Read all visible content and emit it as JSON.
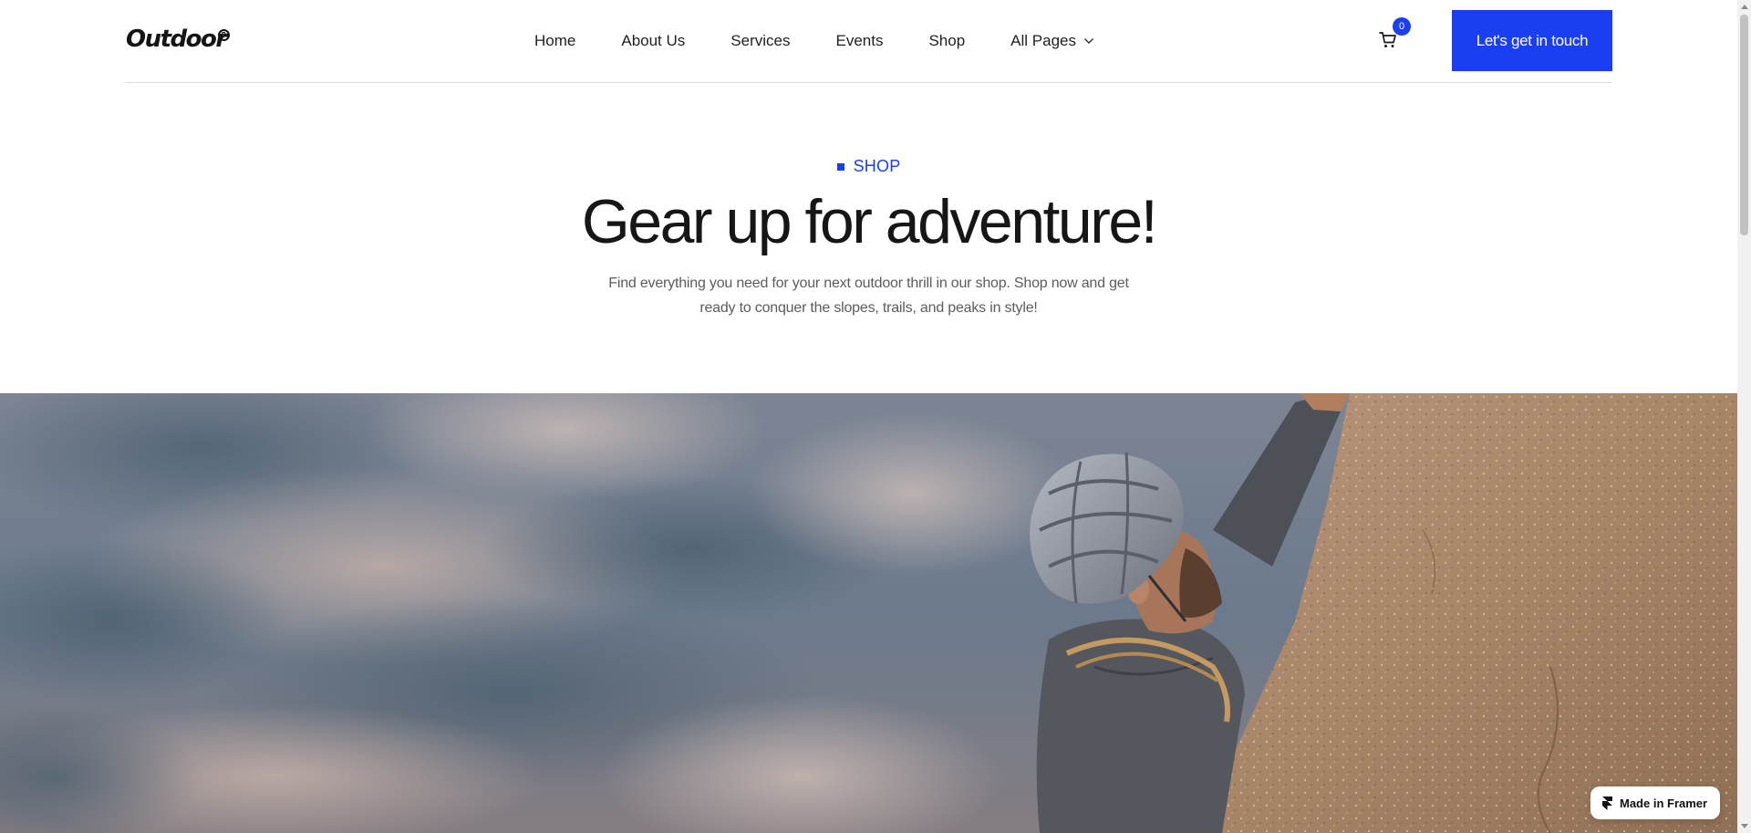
{
  "brand": {
    "name": "Outdoor",
    "mark": "R"
  },
  "nav": {
    "items": [
      {
        "label": "Home"
      },
      {
        "label": "About Us"
      },
      {
        "label": "Services"
      },
      {
        "label": "Events"
      },
      {
        "label": "Shop"
      },
      {
        "label": "All Pages",
        "has_dropdown": true
      }
    ]
  },
  "cart": {
    "count": "0",
    "icon": "cart-icon"
  },
  "cta": {
    "label": "Let's get in touch"
  },
  "hero": {
    "eyebrow": "SHOP",
    "title": "Gear up for adventure!",
    "subtitle": "Find everything you need for your next outdoor thrill in our shop. Shop now and get ready to conquer the slopes, trails, and peaks in style!"
  },
  "badge": {
    "label": "Made in Framer",
    "icon": "framer-icon"
  },
  "colors": {
    "accent": "#1a3ff0",
    "text": "#161616",
    "muted": "#5c5c5c"
  }
}
